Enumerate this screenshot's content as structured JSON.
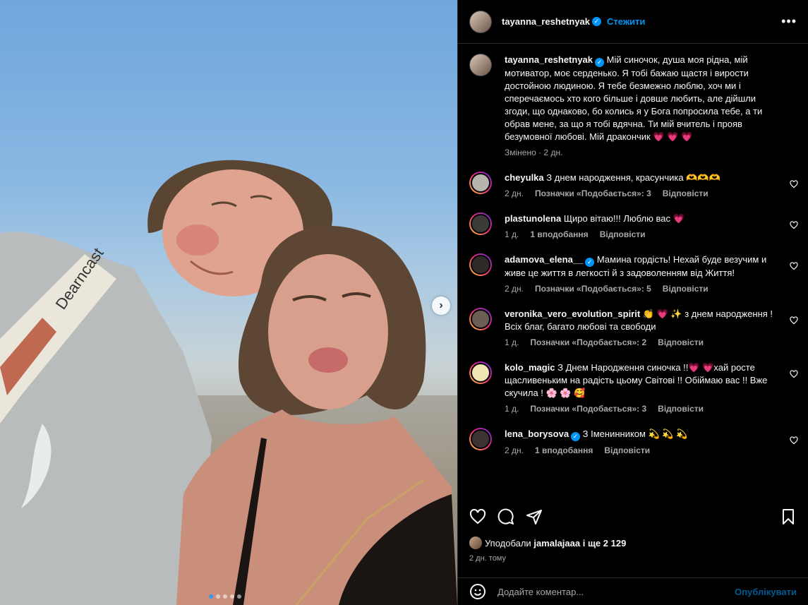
{
  "post": {
    "author": "tayanna_reshetnyak",
    "follow_label": "Стежити",
    "more_icon": "more-horizontal-icon",
    "caption": "Мій синочок, душа моя рідна, мій мотиватор, моє серденько. Я тобі бажаю щастя і вирости достойною людиною. Я тебе безмежно люблю, хоч ми і сперечаємось хто кого більше і довше любить, але дійшли згоди, що однаково, бо колись я у Бога попросила тебе, а ти обрав мене, за що я тобі вдячна. Ти мій вчитель і прояв безумовної любові. Мій дракончик 💗 💗 💗",
    "caption_meta": "Змінено · 2 дн.",
    "media": {
      "bag_text": "Dearncast",
      "carousel_dots": 5,
      "active_dot": 1
    }
  },
  "comments": [
    {
      "user": "cheyulka",
      "verified": false,
      "text": "З днем народження, красунчика 🫶🫶🫶",
      "age": "2 дн.",
      "likes": "Позначки «Подобається»: 3",
      "reply": "Відповісти"
    },
    {
      "user": "plastunolena",
      "verified": false,
      "text": "Щиро вітаю!!! Люблю вас 💗",
      "age": "1 д.",
      "likes": "1 вподобання",
      "reply": "Відповісти"
    },
    {
      "user": "adamova_elena__",
      "verified": true,
      "text": "Мамина гордість! Нехай буде везучим и живе це життя в легкості й з задоволенням від Життя!",
      "age": "2 дн.",
      "likes": "Позначки «Подобається»: 5",
      "reply": "Відповісти"
    },
    {
      "user": "veronika_vero_evolution_spirit",
      "verified": false,
      "text": "👏 💗 ✨ з днем народження ! Всіх благ, багато любові та свободи",
      "age": "1 д.",
      "likes": "Позначки «Подобається»: 2",
      "reply": "Відповісти"
    },
    {
      "user": "kolo_magic",
      "verified": false,
      "text": "З Днем Народження синочка !!💗 💗хай росте щасливеньким на радість цьому Світові !! Обіймаю вас !! Вже скучила ! 🌸 🌸 🥰",
      "age": "1 д.",
      "likes": "Позначки «Подобається»: 3",
      "reply": "Відповісти"
    },
    {
      "user": "lena_borysova",
      "verified": true,
      "text": "З Іменинником 💫 💫 💫",
      "age": "2 дн.",
      "likes": "1 вподобання",
      "reply": "Відповісти"
    }
  ],
  "actions": {
    "like_icon": "heart-icon",
    "comment_icon": "comment-icon",
    "share_icon": "send-icon",
    "save_icon": "bookmark-icon"
  },
  "likes": {
    "prefix": "Уподобали",
    "user": "jamalajaaa",
    "rest": "і ще 2 129"
  },
  "date": "2 дн. тому",
  "add_comment": {
    "placeholder": "Додайте коментар...",
    "publish": "Опублікувати",
    "emoji_icon": "emoji-icon"
  },
  "colors": {
    "accent": "#0095f6",
    "background": "#000000",
    "secondary_text": "#a8a8a8"
  }
}
